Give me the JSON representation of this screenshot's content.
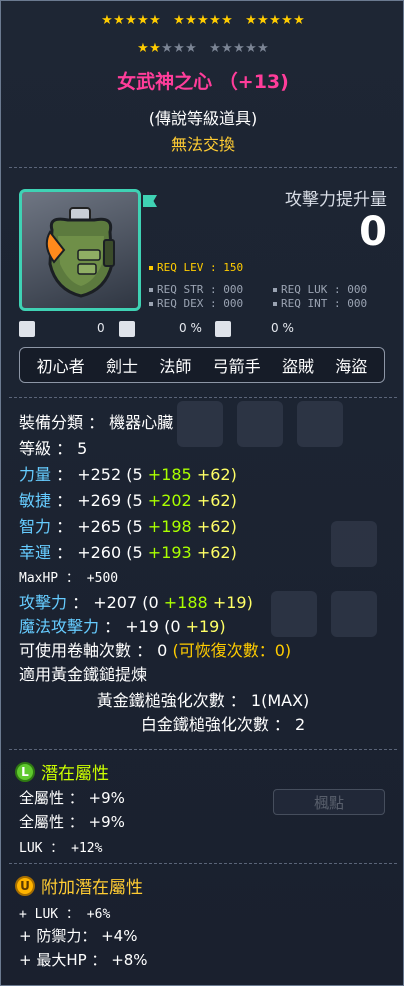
{
  "header": {
    "stars_row1": {
      "gold": 15,
      "total": 15
    },
    "stars_row2": {
      "gold": 2,
      "total": 10
    },
    "item_name": "女武神之心 （+13)",
    "grade": "(傳說等級道具)",
    "trade": "無法交換"
  },
  "attack": {
    "label": "攻擊力提升量",
    "value": "0"
  },
  "requirements": {
    "level": "REQ LEV : 150",
    "str": "REQ STR : 000",
    "luk": "REQ LUK : 000",
    "dex": "REQ DEX : 000",
    "int": "REQ INT : 000"
  },
  "mini_stats": [
    "0",
    "0 %",
    "0 %"
  ],
  "jobs": [
    "初心者",
    "劍士",
    "法師",
    "弓箭手",
    "盜賊",
    "海盜"
  ],
  "stats": {
    "category": "裝備分類 ： 機器心臟",
    "level": "等級 ： 5",
    "str": {
      "k": "力量",
      "total": "+252",
      "base": "(5",
      "a": "+185",
      "b": "+62)"
    },
    "dex": {
      "k": "敏捷",
      "total": "+269",
      "base": "(5",
      "a": "+202",
      "b": "+62)"
    },
    "int": {
      "k": "智力",
      "total": "+265",
      "base": "(5",
      "a": "+198",
      "b": "+62)"
    },
    "luk": {
      "k": "幸運",
      "total": "+260",
      "base": "(5",
      "a": "+193",
      "b": "+62)"
    },
    "maxhp": "MaxHP ： +500",
    "atk": {
      "k": "攻擊力",
      "total": "+207",
      "base": "(0",
      "a": "+188",
      "b": "+19)"
    },
    "matk": {
      "k": "魔法攻擊力",
      "total": "+19",
      "base": "(0",
      "b": "+19)"
    },
    "scroll": "可使用卷軸次數 ： 0",
    "scroll_recover": "(可恢復次數：0)",
    "golden_hammer": "適用黃金鐵鎚提煉",
    "golden_count": "黃金鐵槌強化次數 ： 1(MAX)",
    "platinum_count": "白金鐵槌強化次數 ： 2"
  },
  "potential": {
    "title": "潛在屬性",
    "icon": "L",
    "lines": [
      "全屬性 ： +9%",
      "全屬性 ： +9%",
      "LUK ： +12%"
    ]
  },
  "bonus_potential": {
    "title": "附加潛在屬性",
    "icon": "U",
    "lines": [
      "+ LUK ： +6%",
      "+ 防禦力： +4%",
      "+ 最大HP ： +8%"
    ]
  },
  "background": {
    "button": "楓點"
  },
  "colors": {
    "title": "#ff3d9a",
    "border_legendary": "#3fd2b4",
    "gold": "#ffcc00",
    "stat_blue": "#66ccff",
    "stat_green": "#aaff00"
  }
}
